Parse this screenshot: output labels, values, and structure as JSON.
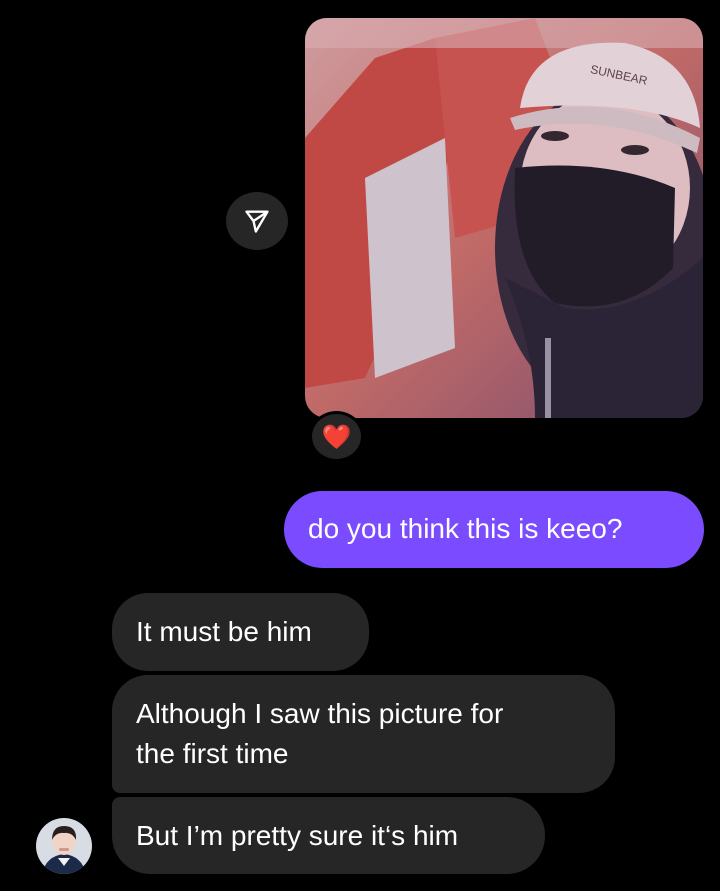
{
  "thread": {
    "shared_media": {
      "alt": "shared reel thumbnail",
      "cap_text": "SUNBEAR"
    },
    "reaction_emoji": "❤️",
    "messages": [
      {
        "side": "outgoing",
        "text": "do you think this is keeo?"
      },
      {
        "side": "incoming",
        "text": "It must be him"
      },
      {
        "side": "incoming",
        "text_line1": "Although I saw this picture for",
        "text_line2": "the first time"
      },
      {
        "side": "incoming",
        "text": "But I’m pretty sure it‘s him"
      }
    ]
  },
  "colors": {
    "outgoing_bubble": "#7b4cff",
    "incoming_bubble": "#262626",
    "background": "#000000"
  },
  "icons": {
    "share": "send-icon",
    "reaction": "heart-icon"
  }
}
